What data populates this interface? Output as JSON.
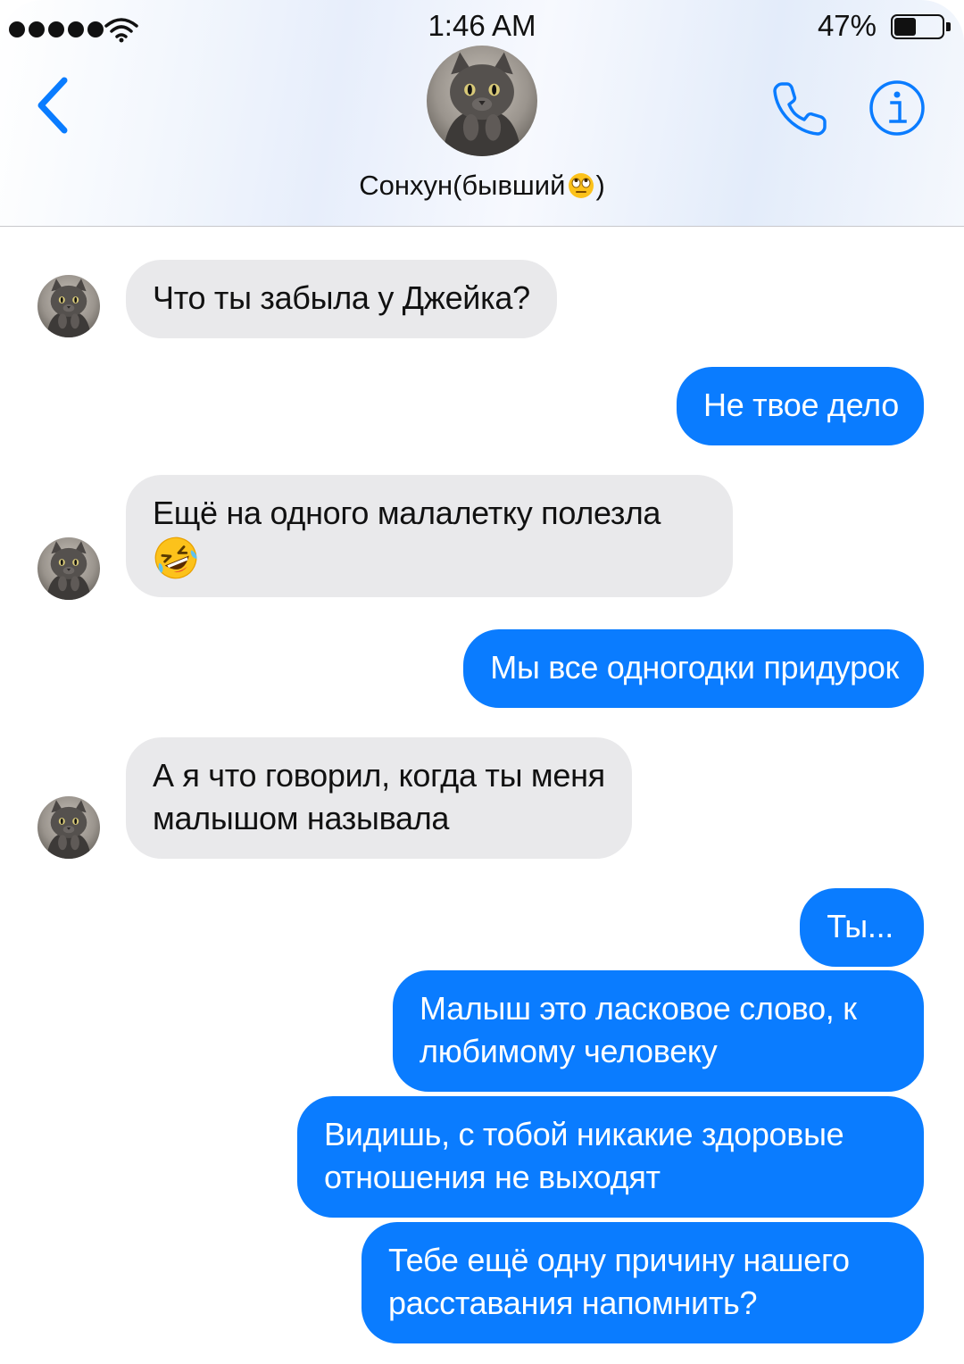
{
  "status_bar": {
    "time": "1:46 AM",
    "battery_percent": "47%",
    "battery_level": 0.47,
    "signal_bars": 5
  },
  "header": {
    "contact_name": "Сонхун(бывший",
    "contact_name_suffix": ")",
    "name_emoji": "face-with-rolling-eyes",
    "back_icon": "chevron-left-icon",
    "call_icon": "phone-icon",
    "info_icon": "info-icon"
  },
  "colors": {
    "accent": "#0a7cff",
    "incoming_bubble": "#e9e9eb",
    "outgoing_bubble": "#0a7cff"
  },
  "messages": [
    {
      "direction": "incoming",
      "text": "Что ты забыла у Джейка?"
    },
    {
      "direction": "outgoing",
      "text": "Не твое дело"
    },
    {
      "direction": "incoming",
      "text": "Ещё на одного малалетку полезла",
      "emoji": "rolling-on-floor-laughing"
    },
    {
      "direction": "outgoing",
      "text": "Мы все одногодки придурок"
    },
    {
      "direction": "incoming",
      "lines": [
        "А я что говорил, когда ты меня",
        "малышом называла"
      ]
    },
    {
      "direction": "outgoing",
      "text": "Ты..."
    },
    {
      "direction": "outgoing",
      "lines": [
        "Малыш это ласковое слово, к",
        "любимому человеку"
      ]
    },
    {
      "direction": "outgoing",
      "lines": [
        "Видишь, с тобой никакие здоровые",
        "отношения не выходят"
      ]
    },
    {
      "direction": "outgoing",
      "lines": [
        "Тебе ещё одну причину нашего",
        "расставания напомнить?"
      ]
    }
  ]
}
